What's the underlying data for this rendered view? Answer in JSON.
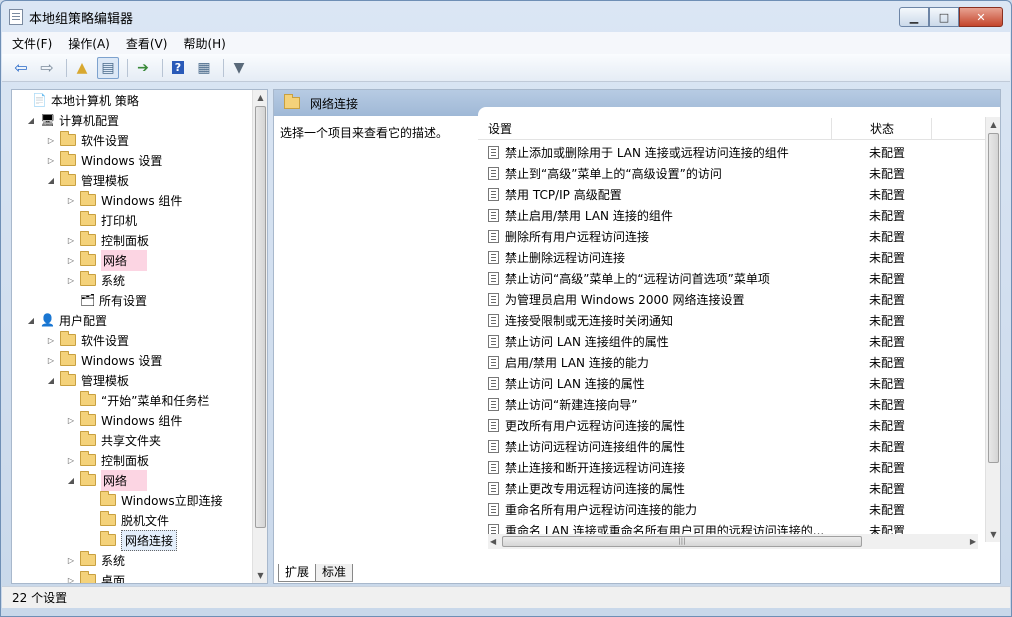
{
  "window": {
    "title": "本地组策略编辑器"
  },
  "menu": [
    "文件(F)",
    "操作(A)",
    "查看(V)",
    "帮助(H)"
  ],
  "toolbar": {
    "icons": [
      "back-icon",
      "forward-icon",
      "up-folder-icon",
      "show-hide-tree-icon",
      "export-list-icon",
      "help-icon",
      "properties-pane-icon",
      "filter-icon"
    ]
  },
  "tree": [
    {
      "label": "本地计算机 策略",
      "level": 0,
      "exp": "",
      "icon": "policy"
    },
    {
      "label": "计算机配置",
      "level": 1,
      "exp": "◢",
      "icon": "computer"
    },
    {
      "label": "软件设置",
      "level": 2,
      "exp": "▷",
      "icon": "folder"
    },
    {
      "label": "Windows 设置",
      "level": 2,
      "exp": "▷",
      "icon": "folder"
    },
    {
      "label": "管理模板",
      "level": 2,
      "exp": "◢",
      "icon": "folder"
    },
    {
      "label": "Windows 组件",
      "level": 3,
      "exp": "▷",
      "icon": "folder"
    },
    {
      "label": "打印机",
      "level": 3,
      "exp": "",
      "icon": "folder"
    },
    {
      "label": "控制面板",
      "level": 3,
      "exp": "▷",
      "icon": "folder"
    },
    {
      "label": "网络",
      "level": 3,
      "exp": "▷",
      "icon": "folder",
      "highlight": true
    },
    {
      "label": "系统",
      "level": 3,
      "exp": "▷",
      "icon": "folder"
    },
    {
      "label": "所有设置",
      "level": 3,
      "exp": "",
      "icon": "settings"
    },
    {
      "label": "用户配置",
      "level": 1,
      "exp": "◢",
      "icon": "user"
    },
    {
      "label": "软件设置",
      "level": 2,
      "exp": "▷",
      "icon": "folder"
    },
    {
      "label": "Windows 设置",
      "level": 2,
      "exp": "▷",
      "icon": "folder"
    },
    {
      "label": "管理模板",
      "level": 2,
      "exp": "◢",
      "icon": "folder"
    },
    {
      "label": "“开始”菜单和任务栏",
      "level": 3,
      "exp": "",
      "icon": "folder"
    },
    {
      "label": "Windows 组件",
      "level": 3,
      "exp": "▷",
      "icon": "folder"
    },
    {
      "label": "共享文件夹",
      "level": 3,
      "exp": "",
      "icon": "folder"
    },
    {
      "label": "控制面板",
      "level": 3,
      "exp": "▷",
      "icon": "folder"
    },
    {
      "label": "网络",
      "level": 3,
      "exp": "◢",
      "icon": "folder",
      "highlight": true
    },
    {
      "label": "Windows立即连接",
      "level": 4,
      "exp": "",
      "icon": "folder"
    },
    {
      "label": "脱机文件",
      "level": 4,
      "exp": "",
      "icon": "folder"
    },
    {
      "label": "网络连接",
      "level": 4,
      "exp": "",
      "icon": "folder",
      "selected": true
    },
    {
      "label": "系统",
      "level": 3,
      "exp": "▷",
      "icon": "folder"
    },
    {
      "label": "桌面",
      "level": 3,
      "exp": "▷",
      "icon": "folder"
    }
  ],
  "right": {
    "header": "网络连接",
    "description": "选择一个项目来查看它的描述。",
    "col_setting": "设置",
    "col_state": "状态",
    "rows": [
      {
        "name": "禁止添加或删除用于 LAN 连接或远程访问连接的组件",
        "state": "未配置"
      },
      {
        "name": "禁止到“高级”菜单上的“高级设置”的访问",
        "state": "未配置"
      },
      {
        "name": "禁用 TCP/IP 高级配置",
        "state": "未配置"
      },
      {
        "name": "禁止启用/禁用 LAN 连接的组件",
        "state": "未配置"
      },
      {
        "name": "删除所有用户远程访问连接",
        "state": "未配置"
      },
      {
        "name": "禁止删除远程访问连接",
        "state": "未配置"
      },
      {
        "name": "禁止访问“高级”菜单上的“远程访问首选项”菜单项",
        "state": "未配置"
      },
      {
        "name": "为管理员启用 Windows 2000 网络连接设置",
        "state": "未配置"
      },
      {
        "name": "连接受限制或无连接时关闭通知",
        "state": "未配置"
      },
      {
        "name": "禁止访问 LAN 连接组件的属性",
        "state": "未配置"
      },
      {
        "name": "启用/禁用 LAN 连接的能力",
        "state": "未配置"
      },
      {
        "name": "禁止访问 LAN 连接的属性",
        "state": "未配置"
      },
      {
        "name": "禁止访问“新建连接向导”",
        "state": "未配置"
      },
      {
        "name": "更改所有用户远程访问连接的属性",
        "state": "未配置"
      },
      {
        "name": "禁止访问远程访问连接组件的属性",
        "state": "未配置"
      },
      {
        "name": "禁止连接和断开连接远程访问连接",
        "state": "未配置"
      },
      {
        "name": "禁止更改专用远程访问连接的属性",
        "state": "未配置"
      },
      {
        "name": "重命名所有用户远程访问连接的能力",
        "state": "未配置"
      },
      {
        "name": "重命名 LAN 连接或重命名所有用户可用的远程访问连接的...",
        "state": "未配置"
      }
    ],
    "tabs": [
      "扩展",
      "标准"
    ]
  },
  "status": "22 个设置"
}
